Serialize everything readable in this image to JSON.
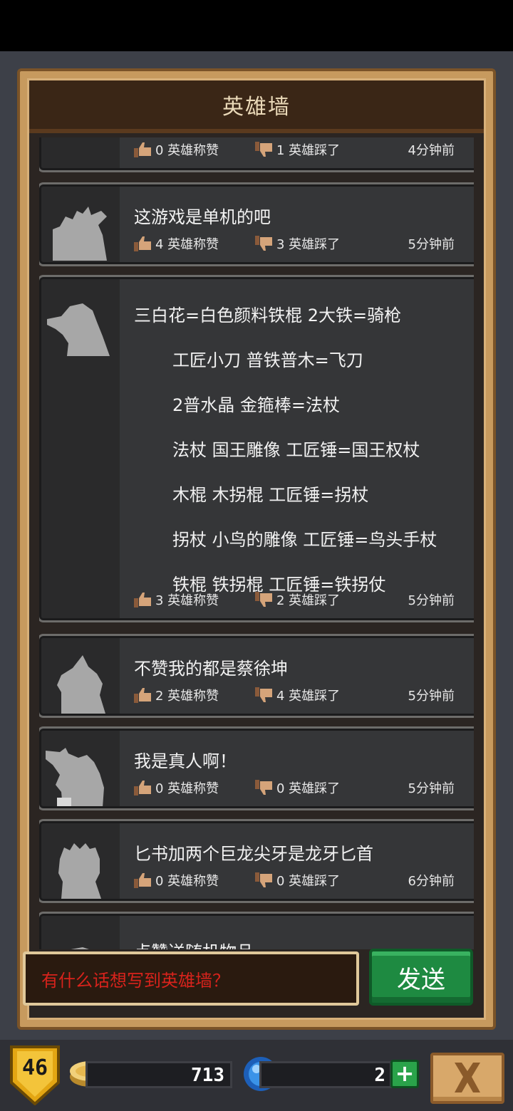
{
  "header": {
    "title": "英雄墙"
  },
  "posts": [
    {
      "message": "",
      "likes": "0 英雄称赞",
      "dislikes": "1 英雄踩了",
      "time": "4分钟前"
    },
    {
      "message": "这游戏是单机的吧",
      "likes": "4 英雄称赞",
      "dislikes": "3 英雄踩了",
      "time": "5分钟前"
    },
    {
      "lines": [
        "三白花=白色颜料铁棍 2大铁=骑枪",
        "工匠小刀 普铁普木=飞刀",
        "2普水晶 金箍棒=法杖",
        "法杖 国王雕像 工匠锤=国王权杖",
        "木棍 木拐棍 工匠锤=拐杖",
        "拐杖 小鸟的雕像 工匠锤=鸟头手杖",
        "铁棍 铁拐棍 工匠锤=铁拐仗"
      ],
      "likes": "3 英雄称赞",
      "dislikes": "2 英雄踩了",
      "time": "5分钟前"
    },
    {
      "message": "不赞我的都是蔡徐坤",
      "likes": "2 英雄称赞",
      "dislikes": "4 英雄踩了",
      "time": "5分钟前"
    },
    {
      "message": "我是真人啊！",
      "likes": "0 英雄称赞",
      "dislikes": "0 英雄踩了",
      "time": "5分钟前"
    },
    {
      "message": "匕书加两个巨龙尖牙是龙牙匕首",
      "likes": "0 英雄称赞",
      "dislikes": "0 英雄踩了",
      "time": "6分钟前"
    },
    {
      "message": "点赞送随机物品"
    }
  ],
  "composer": {
    "placeholder": "有什么话想写到英雄墙？",
    "send_label": "发送"
  },
  "bottom_bar": {
    "level": "46",
    "coins": "713",
    "gems": "2",
    "plus": "+"
  },
  "colors": {
    "accent_green": "#1e8a41",
    "placeholder_red": "#d8231c",
    "frame_gold": "#c79a5e"
  }
}
